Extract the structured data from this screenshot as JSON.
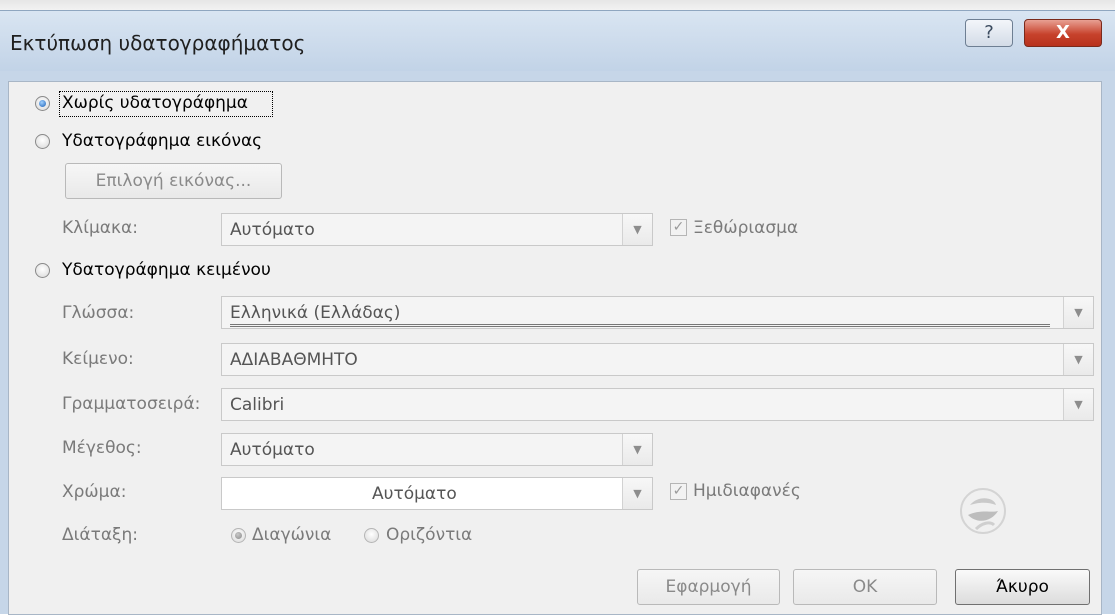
{
  "title": "Εκτύπωση υδατογραφήματος",
  "titlebar_buttons": {
    "help": "?",
    "close": "X"
  },
  "options": {
    "no_watermark": "Χωρίς υδατογράφημα",
    "picture_watermark": "Υδατογράφημα εικόνας",
    "text_watermark": "Υδατογράφημα κειμένου"
  },
  "picture": {
    "select_button": "Επιλογή εικόνας...",
    "scale_label": "Κλίμακα:",
    "scale_value": "Αυτόματο",
    "washout_label": "Ξεθώριασμα"
  },
  "text": {
    "language_label": "Γλώσσα:",
    "language_value": "Ελληνικά (Ελλάδας)",
    "text_label": "Κείμενο:",
    "text_value": "ΑΔΙΑΒΑΘΜΗΤΟ",
    "font_label": "Γραμματοσειρά:",
    "font_value": "Calibri",
    "size_label": "Μέγεθος:",
    "size_value": "Αυτόματο",
    "color_label": "Χρώμα:",
    "color_value": "Αυτόματο",
    "semitransparent_label": "Ημιδιαφανές",
    "layout_label": "Διάταξη:",
    "layout_diagonal": "Διαγώνια",
    "layout_horizontal": "Οριζόντια"
  },
  "buttons": {
    "apply": "Εφαρμογή",
    "ok": "OK",
    "cancel": "Άκυρο"
  },
  "state": {
    "selected_option": "no_watermark",
    "washout_checked": true,
    "semitransparent_checked": true,
    "layout_selected": "diagonal"
  }
}
